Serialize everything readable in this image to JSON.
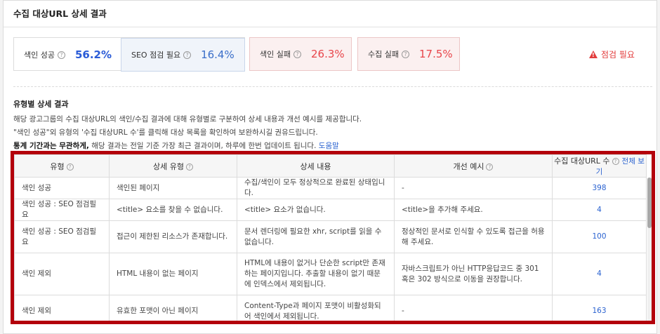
{
  "panel": {
    "title": "수집 대상URL 상세 결과"
  },
  "stats": {
    "index_success": {
      "label": "색인 성공",
      "value": "56.2%"
    },
    "seo_check": {
      "label": "SEO 점검 필요",
      "value": "16.4%"
    },
    "index_fail": {
      "label": "색인 실패",
      "value": "26.3%"
    },
    "crawl_fail": {
      "label": "수집 실패",
      "value": "17.5%"
    },
    "warning": "점검 필요"
  },
  "detail": {
    "heading": "유형별 상세 결과",
    "line1": "해당 광고그룹의 수집 대상URL의 색인/수집 결과에 대해 유형별로 구분하여 상세 내용과 개선 예시를 제공합니다.",
    "line2": "\"색인 성공\"외 유형의 '수집 대상URL 수'를 클릭해 대상 목록을 확인하여 보완하시길 권유드립니다.",
    "line3_bold": "통계 기간과는 무관하게,",
    "line3_rest": " 해당 결과는 전일 기준 가장 최근 결과이며, 하루에 한번 업데이트 됩니다.",
    "help_link": "도움말"
  },
  "table": {
    "headers": {
      "type": "유형",
      "detail_type": "상세 유형",
      "content": "상세 내용",
      "example": "개선 예시",
      "count": "수집 대상URL 수",
      "view_all": "전체 보기"
    },
    "rows": [
      {
        "type": "색인 성공",
        "detail_type": "색인된 페이지",
        "content": "수집/색인이 모두 정상적으로 완료된 상태입니다.",
        "example": "-",
        "count": "398"
      },
      {
        "type": "색인 성공 : SEO 점검필요",
        "detail_type": "<title> 요소를 찾을 수 없습니다.",
        "content": "<title> 요소가 없습니다.",
        "example": "<title>을 추가해 주세요.",
        "count": "4"
      },
      {
        "type": "색인 성공 : SEO 점검필요",
        "detail_type": "접근이 제한된 리소스가 존재합니다.",
        "content": "문서 렌더링에 필요한 xhr, script를 읽을 수 없습니다.",
        "example": "정상적인 문서로 인식할 수 있도록 접근을 허용해 주세요.",
        "count": "100"
      },
      {
        "type": "색인 제외",
        "detail_type": "HTML 내용이 없는 페이지",
        "content": "HTML에 내용이 없거나 단순한 script만 존재하는 페이지입니다. 추출할 내용이 없기 때문에 인덱스에서 제외됩니다.",
        "example": "자바스크립트가 아닌 HTTP응답코드 중 301 혹은 302 방식으로 이동을 권장합니다.",
        "count": "4"
      },
      {
        "type": "색인 제외",
        "detail_type": "유효한 포맷이 아닌 페이지",
        "content": "Content-Type과 페이지 포맷이 비활성화되어 색인에서 제외됩니다.",
        "example": "-",
        "count": "163"
      }
    ]
  }
}
